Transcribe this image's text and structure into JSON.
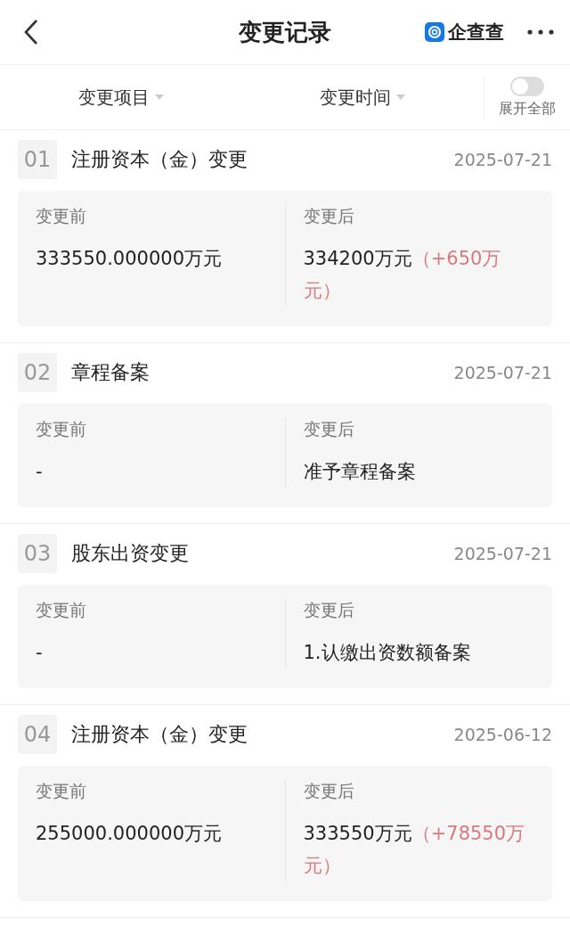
{
  "header": {
    "title": "变更记录",
    "brand": "企查查"
  },
  "filters": [
    {
      "label": "变更项目"
    },
    {
      "label": "变更时间"
    }
  ],
  "expand_all": {
    "label": "展开全部",
    "on": false
  },
  "records": [
    {
      "index": "01",
      "title": "注册资本（金）变更",
      "date": "2025-07-21",
      "before_label": "变更前",
      "before": "333550.000000万元",
      "after_label": "变更后",
      "after": "334200万元",
      "change": "（+650万元）"
    },
    {
      "index": "02",
      "title": "章程备案",
      "date": "2025-07-21",
      "before_label": "变更前",
      "before": "-",
      "after_label": "变更后",
      "after": "准予章程备案"
    },
    {
      "index": "03",
      "title": "股东出资变更",
      "date": "2025-07-21",
      "before_label": "变更前",
      "before": "-",
      "after_label": "变更后",
      "after": "1.认缴出资数额备案"
    },
    {
      "index": "04",
      "title": "注册资本（金）变更",
      "date": "2025-06-12",
      "before_label": "变更前",
      "before": "255000.000000万元",
      "after_label": "变更后",
      "after": "333550万元",
      "change": "（+78550万元）"
    }
  ]
}
